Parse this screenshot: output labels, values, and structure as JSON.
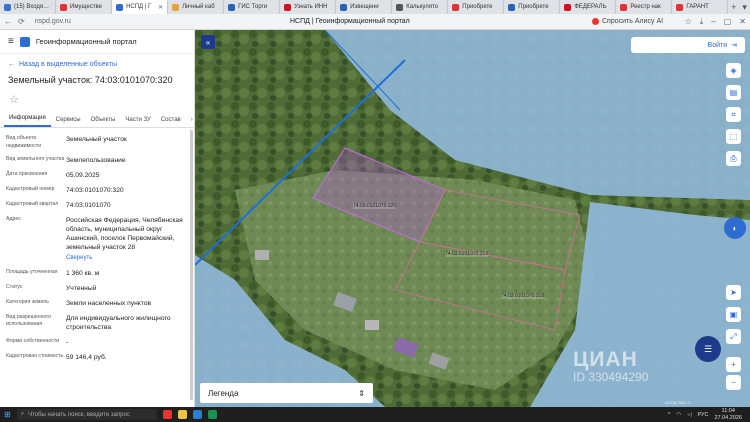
{
  "browser": {
    "tabs": [
      {
        "label": "(15) Входя…",
        "color": "#3a6fd6"
      },
      {
        "label": "Имуществе",
        "color": "#d33"
      },
      {
        "label": "НСПД | Г",
        "color": "#2e6cd1",
        "active": true
      },
      {
        "label": "Личный каб",
        "color": "#e8a33a"
      },
      {
        "label": "ГИС Торги",
        "color": "#2a62b8"
      },
      {
        "label": "Узнать ИНН",
        "color": "#c12"
      },
      {
        "label": "Извещени",
        "color": "#2a62b8"
      },
      {
        "label": "Калькулято",
        "color": "#555"
      },
      {
        "label": "Приобрете",
        "color": "#d33"
      },
      {
        "label": "Приобрете",
        "color": "#2a62b8"
      },
      {
        "label": "ФЕДЕРАЛЬ",
        "color": "#c12"
      },
      {
        "label": "Реестр нак",
        "color": "#d33"
      },
      {
        "label": "ГАРАНТ",
        "color": "#d33"
      }
    ],
    "url": "nspd.gov.ru",
    "page_title": "НСПД | Геоинформационный портал",
    "ai_button": "Спросить Алису AI"
  },
  "sidebar": {
    "portal_title": "Геоинформационный портал",
    "back_link": "Назад в выделенные объекты",
    "object_title": "Земельный участок: 74:03:0101070:320",
    "tabs": [
      "Информация",
      "Сервисы",
      "Объекты",
      "Части ЗУ",
      "Состав"
    ],
    "rows": [
      {
        "key": "Вид объекта недвижимости",
        "value": "Земельный участок"
      },
      {
        "key": "Вид земельного участка",
        "value": "Землепользование"
      },
      {
        "key": "Дата присвоения",
        "value": "05.09.2025"
      },
      {
        "key": "Кадастровый номер",
        "value": "74:03:0101070:320"
      },
      {
        "key": "Кадастровый квартал",
        "value": "74:03:0101070"
      },
      {
        "key": "Адрес",
        "value": "Российская Федерация, Челябинская область, муниципальный округ Ашинский, поселок Первомайский, земельный участок 28",
        "link": "Свернуть"
      },
      {
        "key": "Площадь уточненная",
        "value": "1 360 кв. м"
      },
      {
        "key": "Статус",
        "value": "Учтенный"
      },
      {
        "key": "Категория земель",
        "value": "Земли населенных пунктов"
      },
      {
        "key": "Вид разрешенного использования",
        "value": "Для индивидуального жилищного строительства"
      },
      {
        "key": "Форма собственности",
        "value": "-"
      },
      {
        "key": "Кадастровая стоимость",
        "value": "59 146,4 руб."
      }
    ]
  },
  "map": {
    "login": "Войти",
    "legend": "Легенда",
    "parcel_labels": [
      "74:03:0101070:320",
      "74:03:0101070:319",
      "74:03:0101070:318"
    ],
    "watermark": "ЦИАН",
    "watermark_id": "ID 330494290",
    "scale_text": "НСПД 2025 ©",
    "colors": {
      "water": "#8fb7d6",
      "parcel_fill": "#b05bd6",
      "cadastral_line": "#1f6fd8"
    }
  },
  "taskbar": {
    "search_placeholder": "Чтобы начать поиск, введите запрос",
    "lang": "РУС",
    "time": "11:04",
    "date": "27.04.2026"
  }
}
